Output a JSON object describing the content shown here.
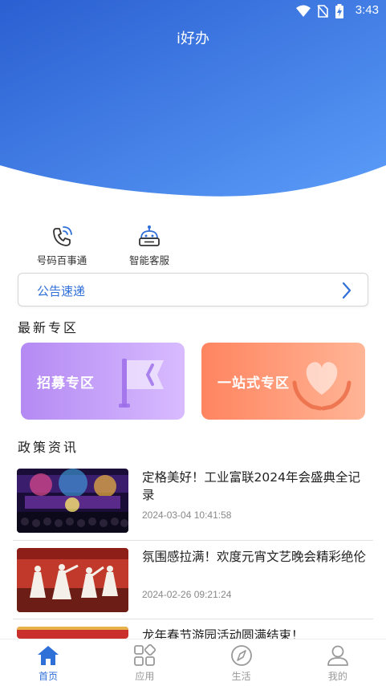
{
  "status_bar": {
    "time": "3:43",
    "icons": [
      "wifi-icon",
      "no-sim-icon",
      "battery-charging-icon"
    ]
  },
  "header": {
    "title": "i好办"
  },
  "quick_actions": [
    {
      "label": "号码百事通",
      "icon": "phone-call-icon"
    },
    {
      "label": "智能客服",
      "icon": "robot-icon"
    }
  ],
  "notice": {
    "label": "公告速递",
    "icon": "chevron-right-icon"
  },
  "latest": {
    "title": "最新专区",
    "cards": [
      {
        "label": "招募专区",
        "icon": "flag-icon",
        "gradient": [
          "#b98cf5",
          "#d7b8ff"
        ]
      },
      {
        "label": "一站式专区",
        "icon": "heart-hands-icon",
        "gradient": [
          "#ff8a66",
          "#ffb79a"
        ]
      }
    ]
  },
  "policy": {
    "title": "政策资讯",
    "items": [
      {
        "title": "定格美好！工业富联2024年会盛典全记录",
        "date": "2024-03-04 10:41:58"
      },
      {
        "title": "氛围感拉满！欢度元宵文艺晚会精彩绝伦",
        "date": "2024-02-26 09:21:24"
      },
      {
        "title": "龙年春节游园活动圆满结束！",
        "date": ""
      }
    ]
  },
  "tabbar": {
    "tabs": [
      {
        "label": "首页",
        "icon": "home-icon",
        "active": true
      },
      {
        "label": "应用",
        "icon": "apps-grid-icon",
        "active": false
      },
      {
        "label": "生活",
        "icon": "compass-icon",
        "active": false
      },
      {
        "label": "我的",
        "icon": "profile-icon",
        "active": false
      }
    ]
  },
  "colors": {
    "accent": "#2f6fd8",
    "hero_start": "#2a66d6",
    "hero_end": "#5a9af7"
  }
}
